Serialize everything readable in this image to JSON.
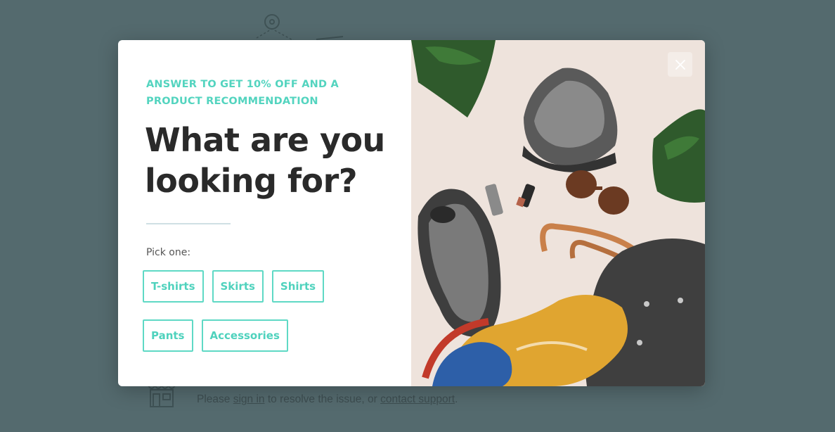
{
  "background": {
    "line_prefix": "Please",
    "sign_in_link": "sign in",
    "line_middle": "to resolve the issue, or",
    "contact_link": "contact support",
    "line_suffix": "."
  },
  "modal": {
    "eyebrow": "ANSWER TO GET 10% OFF AND A PRODUCT RECOMMENDATION",
    "headline": "What are you looking for?",
    "pick_label": "Pick one:",
    "options_row1": [
      "T-shirts",
      "Skirts",
      "Shirts"
    ],
    "options_row2": [
      "Pants",
      "Accessories"
    ],
    "close_icon": "close-icon",
    "photo_description_icon": "product-flatlay-image"
  },
  "colors": {
    "overlay": "#546a6e",
    "accent": "#53d4bf",
    "headline": "#2a2a2a",
    "photo_bg": "#eee3dc"
  }
}
